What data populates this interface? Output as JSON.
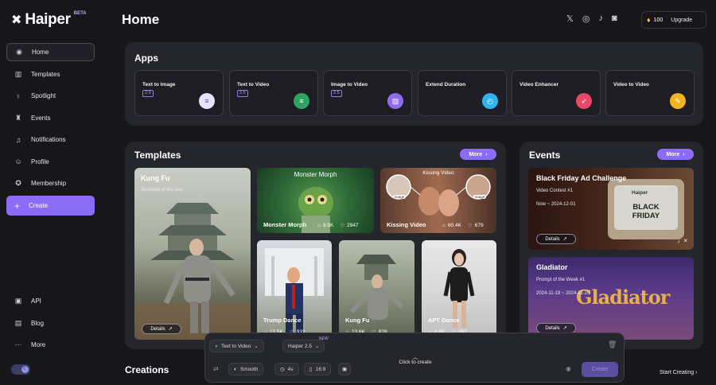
{
  "brand": {
    "name": "Haiper",
    "beta": "BETA"
  },
  "colors": {
    "accent": "#8b6cf6",
    "background": "#17171b",
    "panel": "#25252c"
  },
  "sidebar": {
    "items": [
      {
        "label": "Home",
        "icon": "compass-icon"
      },
      {
        "label": "Templates",
        "icon": "templates-icon"
      },
      {
        "label": "Spotlight",
        "icon": "lightbulb-icon"
      },
      {
        "label": "Events",
        "icon": "trophy-icon"
      },
      {
        "label": "Notifications",
        "icon": "bell-icon"
      },
      {
        "label": "Profile",
        "icon": "user-icon"
      },
      {
        "label": "Membership",
        "icon": "badge-icon"
      }
    ],
    "create": "Create",
    "bottom": [
      {
        "label": "API",
        "icon": "api-icon"
      },
      {
        "label": "Blog",
        "icon": "blog-icon"
      },
      {
        "label": "More",
        "icon": "more-dots-icon"
      }
    ]
  },
  "header": {
    "title": "Home",
    "credits": "100",
    "upgrade": "Upgrade"
  },
  "apps": {
    "title": "Apps",
    "cards": [
      {
        "name": "Text to Image",
        "version": "2.0",
        "color": "#e7e3ff"
      },
      {
        "name": "Text to Video",
        "version": "2.5",
        "color": "#2fa35f"
      },
      {
        "name": "Image to Video",
        "version": "2.5",
        "color": "#8f6bf0"
      },
      {
        "name": "Extend Duration",
        "version": "",
        "color": "#2fb4f0"
      },
      {
        "name": "Video Enhancer",
        "version": "",
        "color": "#e84867"
      },
      {
        "name": "Video to Video",
        "version": "",
        "color": "#f2b41c"
      }
    ]
  },
  "templates": {
    "title": "Templates",
    "more": "More",
    "featured": {
      "name": "Kung Fu",
      "sub": "Template of the day",
      "details": "Details"
    },
    "cards": [
      {
        "name": "Monster Morph",
        "overlay": "Monster Morph",
        "uses": "9.5K",
        "likes": "2947"
      },
      {
        "name": "Kissing Video",
        "overlay": "Kissing Video",
        "uses": "60.4K",
        "likes": "679",
        "tag1": "image",
        "tag2": "image"
      },
      {
        "name": "Trump Dance",
        "uses": "17.5K",
        "likes": "932"
      },
      {
        "name": "Kung Fu",
        "uses": "13.6K",
        "likes": "828"
      },
      {
        "name": "APT Dance",
        "uses": "6.8K",
        "likes": "397"
      }
    ]
  },
  "events": {
    "title": "Events",
    "more": "More",
    "cards": [
      {
        "title": "Black Friday Ad Challenge",
        "sub": "Video Contest #1",
        "date": "Now ~ 2024-12-01",
        "details": "Details",
        "screen_brand": "Haiper",
        "screen_text": "BLACK FRIDAY"
      },
      {
        "title": "Gladiator",
        "sub": "Prompt of the Week #1",
        "date": "2024-11-19 ~ 2024-11-25",
        "details": "Details",
        "art_text": "Gladiator"
      }
    ]
  },
  "creations": {
    "title": "Creations",
    "start": "Start Creating"
  },
  "composer": {
    "mode": "Text to Video",
    "model": "Haiper 2.5",
    "new_badge": "NEW",
    "click": "Click to create",
    "style": "Smooth",
    "duration": "4s",
    "ratio": "16:9",
    "create": "Create"
  }
}
